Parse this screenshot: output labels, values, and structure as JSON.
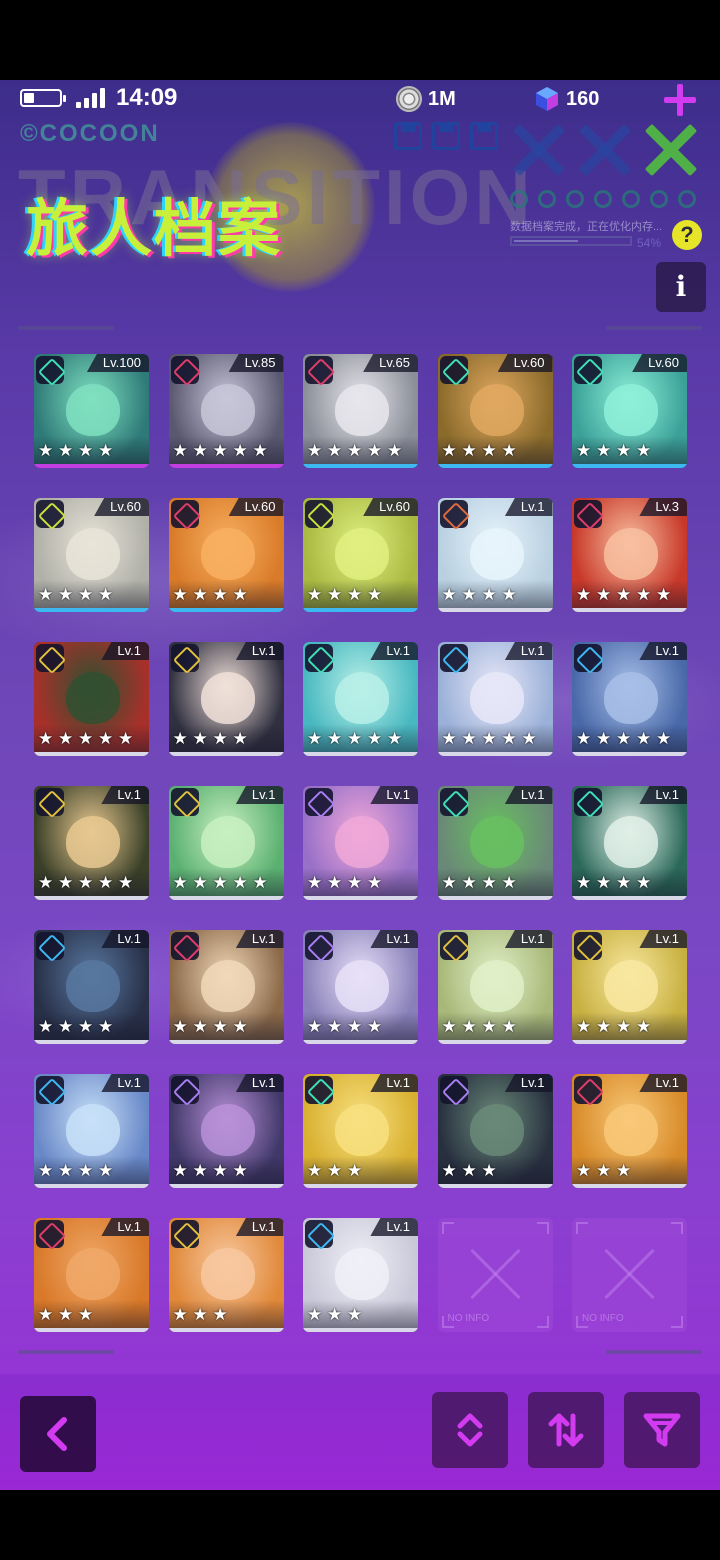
{
  "status_bar": {
    "time": "14:09",
    "coins": "1M",
    "gems": "160"
  },
  "header": {
    "title": "旅人档案",
    "brand": "©COCOON",
    "watermark": "TRANSITION",
    "loading_text": "数据档案完成，正在优化内存...",
    "loading_percent": "54%",
    "loading_fraction": 0.54
  },
  "buttons": {
    "help": "?",
    "info": "i"
  },
  "characters": [
    {
      "level": "Lv.100",
      "stars": 4,
      "bg": "#2e7a78",
      "face": "#7fe0c0",
      "icon": "#3ee0b8",
      "underline": "#c23ee0"
    },
    {
      "level": "Lv.85",
      "stars": 5,
      "bg": "#5a5870",
      "face": "#c8c6d8",
      "icon": "#e03e6a",
      "underline": "#c23ee0"
    },
    {
      "level": "Lv.65",
      "stars": 5,
      "bg": "#8a8e98",
      "face": "#e8e6ec",
      "icon": "#e03e6a",
      "underline": "#3eb8f0"
    },
    {
      "level": "Lv.60",
      "stars": 4,
      "bg": "#8a6a2a",
      "face": "#e0a860",
      "icon": "#3ee0b8",
      "underline": "#3eb8f0"
    },
    {
      "level": "Lv.60",
      "stars": 4,
      "bg": "#3aa098",
      "face": "#8ef0d8",
      "icon": "#3ee0b8",
      "underline": "#3eb8f0"
    },
    {
      "level": "Lv.60",
      "stars": 4,
      "bg": "#b0b0a8",
      "face": "#e8e4d8",
      "icon": "#c8e03e",
      "underline": "#3eb8f0"
    },
    {
      "level": "Lv.60",
      "stars": 4,
      "bg": "#d87a28",
      "face": "#f8b060",
      "icon": "#e03e6a",
      "underline": "#3eb8f0"
    },
    {
      "level": "Lv.60",
      "stars": 4,
      "bg": "#a8b840",
      "face": "#e0f080",
      "icon": "#c8e03e",
      "underline": "#3eb8f0"
    },
    {
      "level": "Lv.1",
      "stars": 4,
      "bg": "#b8d0e0",
      "face": "#e8f4fc",
      "icon": "#e06a3e",
      "underline": "#d8d8e8"
    },
    {
      "level": "Lv.3",
      "stars": 5,
      "bg": "#c8382a",
      "face": "#f8c0a0",
      "icon": "#e03e6a",
      "underline": "#d8d8e8"
    },
    {
      "level": "Lv.1",
      "stars": 5,
      "bg": "#a8302a",
      "face": "#305030",
      "icon": "#e0c03e",
      "underline": "#d8d8e8"
    },
    {
      "level": "Lv.1",
      "stars": 4,
      "bg": "#303040",
      "face": "#f0e0d8",
      "icon": "#e0c03e",
      "underline": "#d8d8e8"
    },
    {
      "level": "Lv.1",
      "stars": 5,
      "bg": "#48b8c0",
      "face": "#b8f0e8",
      "icon": "#3ee0b8",
      "underline": "#d8d8e8"
    },
    {
      "level": "Lv.1",
      "stars": 5,
      "bg": "#9ab0d8",
      "face": "#e8e8f8",
      "icon": "#3eb8f0",
      "underline": "#d8d8e8"
    },
    {
      "level": "Lv.1",
      "stars": 5,
      "bg": "#4868a8",
      "face": "#a8c0e8",
      "icon": "#3eb8f0",
      "underline": "#d8d8e8"
    },
    {
      "level": "Lv.1",
      "stars": 5,
      "bg": "#3a4028",
      "face": "#e8c890",
      "icon": "#e0c03e",
      "underline": "#d8d8e8"
    },
    {
      "level": "Lv.1",
      "stars": 5,
      "bg": "#5ab070",
      "face": "#c8f0c0",
      "icon": "#e0c03e",
      "underline": "#d8d8e8"
    },
    {
      "level": "Lv.1",
      "stars": 4,
      "bg": "#9870c8",
      "face": "#f0a8d8",
      "icon": "#a87ef0",
      "underline": "#d8d8e8"
    },
    {
      "level": "Lv.1",
      "stars": 4,
      "bg": "#6a8878",
      "face": "#68c060",
      "icon": "#3ee0b8",
      "underline": "#d8d8e8"
    },
    {
      "level": "Lv.1",
      "stars": 4,
      "bg": "#2a6858",
      "face": "#e0f0e8",
      "icon": "#3ee0b8",
      "underline": "#d8d8e8"
    },
    {
      "level": "Lv.1",
      "stars": 4,
      "bg": "#283048",
      "face": "#5878a0",
      "icon": "#3eb8f0",
      "underline": "#d8d8e8"
    },
    {
      "level": "Lv.1",
      "stars": 4,
      "bg": "#8a6848",
      "face": "#f0d8b8",
      "icon": "#e03e6a",
      "underline": "#d8d8e8"
    },
    {
      "level": "Lv.1",
      "stars": 4,
      "bg": "#8880b8",
      "face": "#e8e0f8",
      "icon": "#a87ef0",
      "underline": "#d8d8e8"
    },
    {
      "level": "Lv.1",
      "stars": 4,
      "bg": "#a8b878",
      "face": "#e0f0c8",
      "icon": "#e0c03e",
      "underline": "#d8d8e8"
    },
    {
      "level": "Lv.1",
      "stars": 4,
      "bg": "#c8b040",
      "face": "#f8e8a0",
      "icon": "#e0c03e",
      "underline": "#d8d8e8"
    },
    {
      "level": "Lv.1",
      "stars": 4,
      "bg": "#6888c8",
      "face": "#c8e0f8",
      "icon": "#3eb8f0",
      "underline": "#d8d8e8"
    },
    {
      "level": "Lv.1",
      "stars": 4,
      "bg": "#403868",
      "face": "#b890d8",
      "icon": "#a87ef0",
      "underline": "#d8d8e8"
    },
    {
      "level": "Lv.1",
      "stars": 3,
      "bg": "#d8b030",
      "face": "#f8e080",
      "icon": "#3ee0b8",
      "underline": "#d8d8e8"
    },
    {
      "level": "Lv.1",
      "stars": 3,
      "bg": "#283040",
      "face": "#6a8a78",
      "icon": "#a87ef0",
      "underline": "#d8d8e8"
    },
    {
      "level": "Lv.1",
      "stars": 3,
      "bg": "#d88a28",
      "face": "#f8c878",
      "icon": "#e03e6a",
      "underline": "#d8d8e8"
    },
    {
      "level": "Lv.1",
      "stars": 3,
      "bg": "#d87828",
      "face": "#f0a868",
      "icon": "#e03e6a",
      "underline": "#d8d8e8"
    },
    {
      "level": "Lv.1",
      "stars": 3,
      "bg": "#e08838",
      "face": "#f8c8a0",
      "icon": "#e0c03e",
      "underline": "#d8d8e8"
    },
    {
      "level": "Lv.1",
      "stars": 3,
      "bg": "#c8c8d8",
      "face": "#f0f0f8",
      "icon": "#3eb8f0",
      "underline": "#d8d8e8"
    }
  ],
  "empty_slots": [
    {
      "label": "NO INFO"
    },
    {
      "label": "NO INFO"
    }
  ],
  "footer": {
    "back": "back-icon",
    "sort_order": "sort-order-icon",
    "swap": "swap-icon",
    "filter": "filter-icon"
  }
}
